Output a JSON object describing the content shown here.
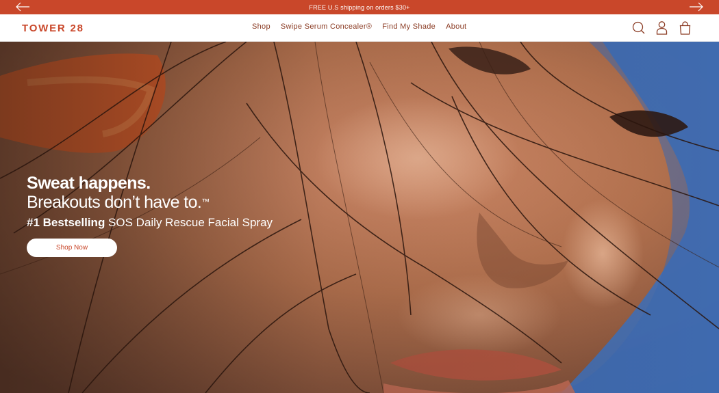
{
  "announcement": {
    "text": "FREE U.S shipping on orders $30+",
    "prev_icon": "arrow-left-icon",
    "next_icon": "arrow-right-icon"
  },
  "header": {
    "logo": "TOWER 28",
    "nav": [
      "Shop",
      "Swipe Serum Concealer®",
      "Find My Shade",
      "About"
    ],
    "icons": [
      "search-icon",
      "account-icon",
      "cart-icon"
    ]
  },
  "hero": {
    "headline_bold": "Sweat happens.",
    "headline_light": "Breakouts don’t have to.",
    "headline_mark": "™",
    "sub_bold": "#1 Bestselling",
    "sub_text": " SOS Daily Rescue Facial Spray",
    "cta_label": "Shop Now"
  },
  "colors": {
    "brand": "#c9472a",
    "nav_text": "#8a3a22"
  }
}
